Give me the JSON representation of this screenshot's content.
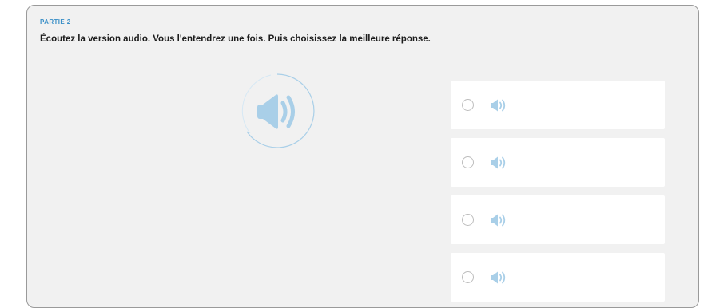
{
  "exercise": {
    "part_label": "PARTIE 2",
    "instruction": "Écoutez la version audio. Vous l'entendrez une fois. Puis choisissez la meilleure réponse."
  },
  "main_audio": {
    "icon": "speaker-icon",
    "color": "#a9cfe8"
  },
  "options": [
    {
      "icon": "speaker-icon",
      "selected": false
    },
    {
      "icon": "speaker-icon",
      "selected": false
    },
    {
      "icon": "speaker-icon",
      "selected": false
    },
    {
      "icon": "speaker-icon",
      "selected": false
    }
  ],
  "colors": {
    "accent": "#3a8fc7",
    "speaker": "#a9cfe8",
    "panel_bg": "#f1f1f1",
    "option_bg": "#ffffff"
  }
}
